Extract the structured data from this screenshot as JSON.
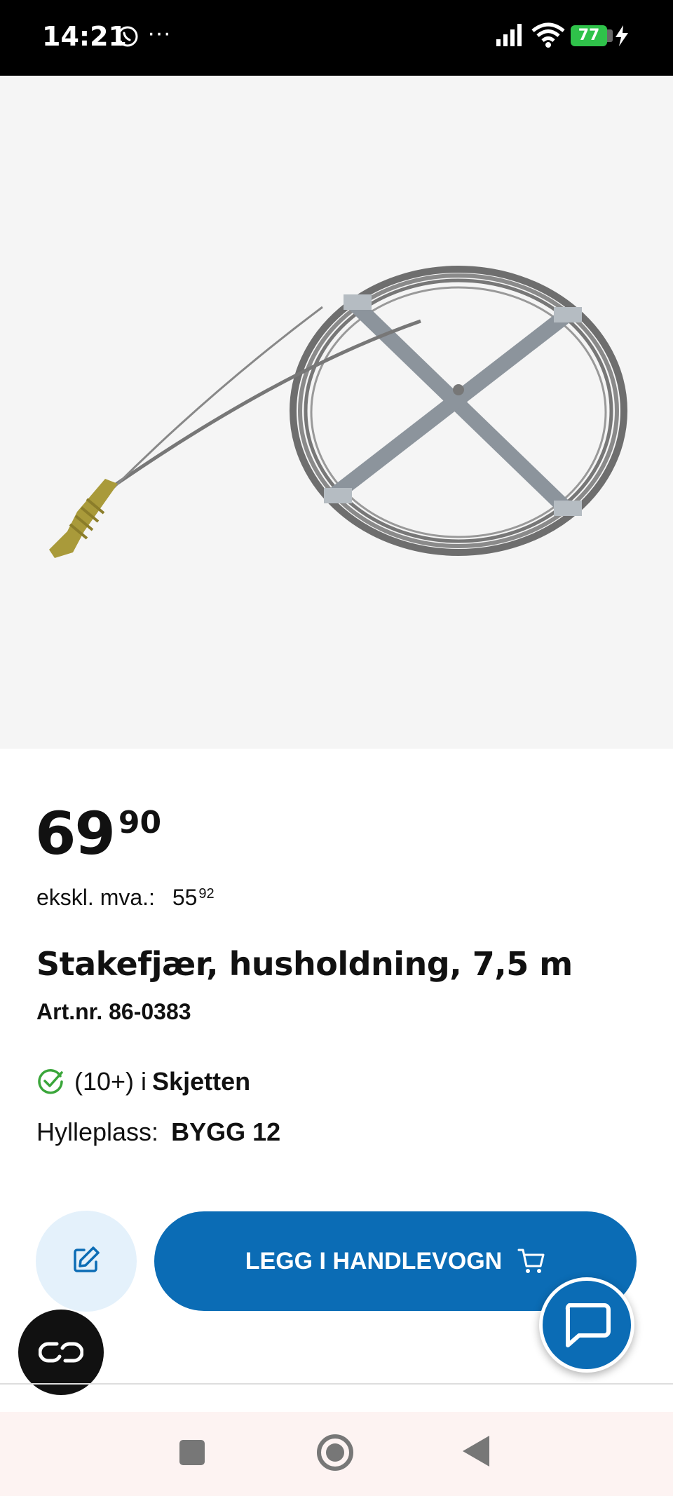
{
  "status_bar": {
    "time": "14:21",
    "dots": "···",
    "battery": "77"
  },
  "product": {
    "price_int": "69",
    "price_dec": "90",
    "exvat_label": "ekskl. mva.:",
    "exvat_int": "55",
    "exvat_dec": "92",
    "title": "Stakefjær, husholdning, 7,5 m",
    "art_nr": "Art.nr. 86-0383",
    "stock_count": "(10+) i",
    "stock_store": "Skjetten",
    "shelf_label": "Hylleplass:",
    "shelf_value": "BYGG 12"
  },
  "actions": {
    "cart_label": "LEGG I HANDLEVOGN"
  },
  "colors": {
    "primary": "#0b6cb5",
    "edit_bg": "#e4f1fb",
    "stock_green": "#3aa63a",
    "status_bar": "#000000",
    "battery": "#2fc24a"
  },
  "icons": [
    "whatsapp-icon",
    "signal-icon",
    "wifi-icon",
    "charging-icon",
    "check-circle-icon",
    "edit-icon",
    "cart-icon",
    "chat-icon",
    "glasses-icon",
    "nav-recents-icon",
    "nav-home-icon",
    "nav-back-icon"
  ]
}
